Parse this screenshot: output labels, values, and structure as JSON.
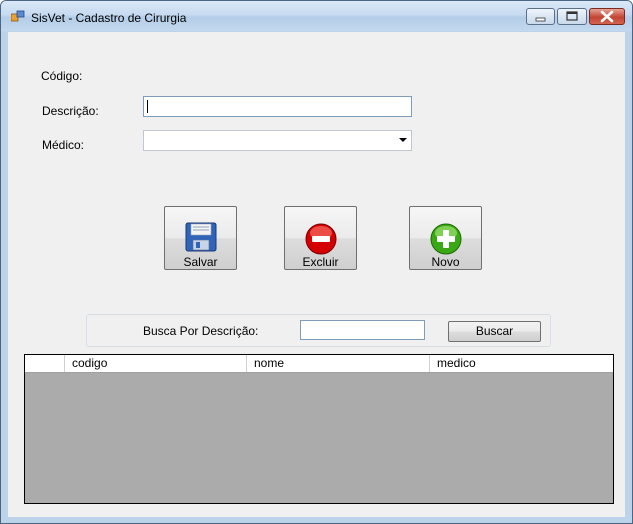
{
  "window": {
    "title": "SisVet - Cadastro de Cirurgia",
    "app_icon": "app-icon",
    "controls": [
      "minimize-icon",
      "maximize-icon",
      "close-icon"
    ]
  },
  "form": {
    "codigo_label": "Código:",
    "descricao_label": "Descrição:",
    "descricao_value": "",
    "medico_label": "Médico:",
    "medico_selected": ""
  },
  "actions": {
    "salvar_label": "Salvar",
    "excluir_label": "Excluir",
    "novo_label": "Novo"
  },
  "search": {
    "label": "Busca Por Descrição:",
    "value": "",
    "button_label": "Buscar"
  },
  "grid": {
    "columns": [
      "codigo",
      "nome",
      "medico"
    ],
    "rows": []
  },
  "colors": {
    "excluir_red": "#d40000",
    "novo_green": "#3aa814",
    "salvar_blue": "#2f64b8"
  }
}
